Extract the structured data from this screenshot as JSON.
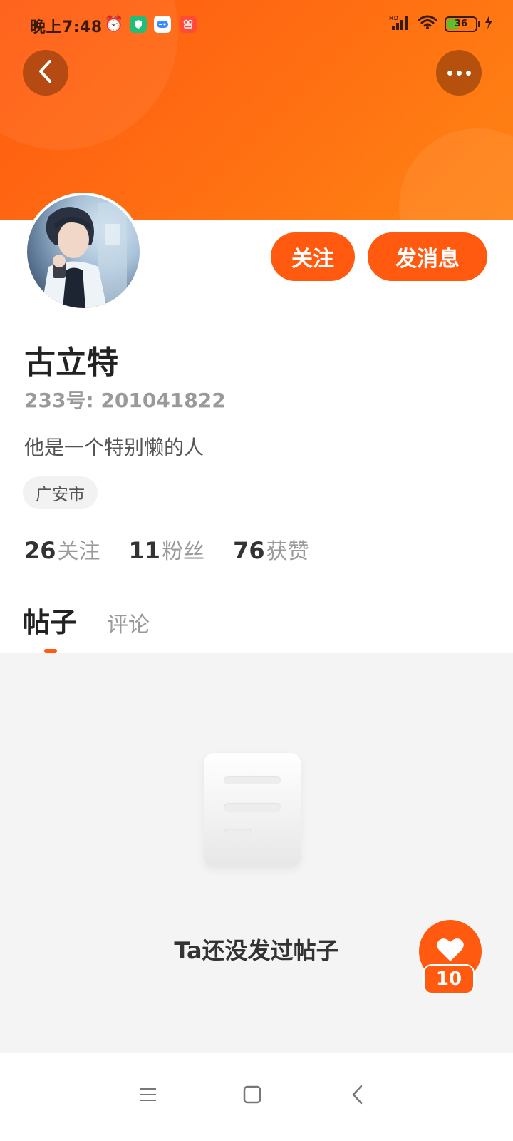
{
  "status_bar": {
    "time": "晚上7:48",
    "battery": "36",
    "signal_label": "HD"
  },
  "profile": {
    "name": "古立特",
    "uid": "233号: 201041822",
    "bio": "他是一个特别懒的人",
    "location": "广安市",
    "stats": [
      {
        "num": "26",
        "label": "关注"
      },
      {
        "num": "11",
        "label": "粉丝"
      },
      {
        "num": "76",
        "label": "获赞"
      }
    ]
  },
  "actions": {
    "follow_label": "关注",
    "message_label": "发消息"
  },
  "tabs": {
    "active": "帖子",
    "inactive": "评论"
  },
  "empty_state": {
    "text": "Ta还没发过帖子"
  },
  "like": {
    "count": "10"
  },
  "colors": {
    "accent": "#ff5a10",
    "banner_start": "#ff5a10",
    "banner_end": "#ff8414",
    "content_bg": "#f4f4f4"
  },
  "icons": {
    "back": "chevron-left-icon",
    "more": "more-dots-icon",
    "like": "heart-icon",
    "nav_menu": "menu-icon",
    "nav_home": "square-home-icon",
    "nav_back": "chevron-left-icon"
  }
}
